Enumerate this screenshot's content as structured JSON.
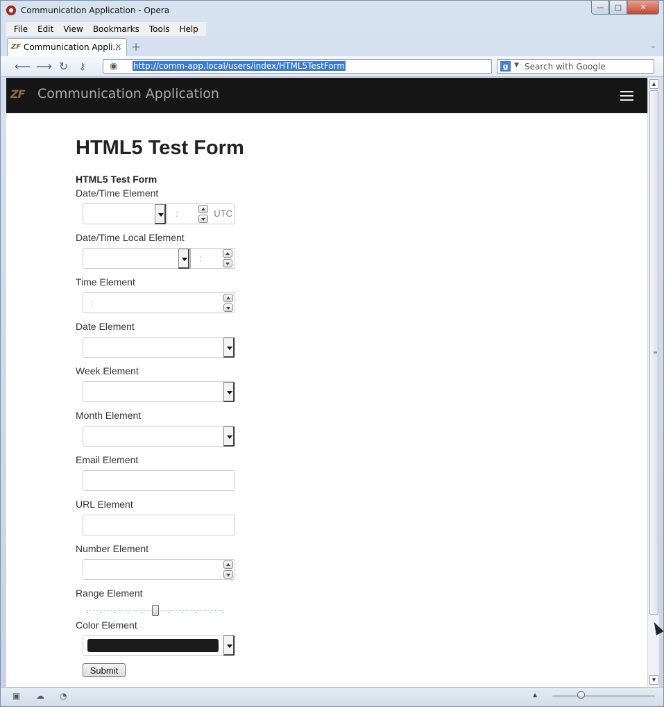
{
  "window": {
    "title": "Communication Application - Opera",
    "icon": "opera-logo-icon",
    "controls": {
      "minimize": "—",
      "maximize": "□",
      "close": "✕"
    }
  },
  "menu": {
    "items": [
      {
        "label": "File"
      },
      {
        "label": "Edit"
      },
      {
        "label": "View"
      },
      {
        "label": "Bookmarks"
      },
      {
        "label": "Tools"
      },
      {
        "label": "Help"
      }
    ]
  },
  "tabs": {
    "active": {
      "label": "Communication Appli...",
      "favicon": "ZF"
    },
    "new_tab_symbol": "+",
    "list_symbol": "⌄"
  },
  "address": {
    "url": "http://comm-app.local/users/index/HTML5TestForm",
    "search_placeholder": "Search with Google",
    "search_engine_letter": "g"
  },
  "site": {
    "logo": "ZF",
    "brand": "Communication Application"
  },
  "page": {
    "title": "HTML5 Test Form"
  },
  "form": {
    "legend": "HTML5 Test Form",
    "fields": [
      {
        "label": "Date/Time Element",
        "type": "datetime",
        "timezone": "UTC",
        "separator": ":"
      },
      {
        "label": "Date/Time Local Element",
        "type": "datetime-local",
        "separator": ":"
      },
      {
        "label": "Time Element",
        "type": "time",
        "separator": ":"
      },
      {
        "label": "Date Element",
        "type": "date"
      },
      {
        "label": "Week Element",
        "type": "week"
      },
      {
        "label": "Month Element",
        "type": "month"
      },
      {
        "label": "Email Element",
        "type": "email"
      },
      {
        "label": "URL Element",
        "type": "url"
      },
      {
        "label": "Number Element",
        "type": "number"
      },
      {
        "label": "Range Element",
        "type": "range",
        "value_fraction": 0.5
      },
      {
        "label": "Color Element",
        "type": "color",
        "value": "#1a1a1a"
      }
    ],
    "submit_label": "Submit"
  },
  "colors": {
    "navbar": "#161616",
    "url_selection": "#3c7bd4"
  }
}
